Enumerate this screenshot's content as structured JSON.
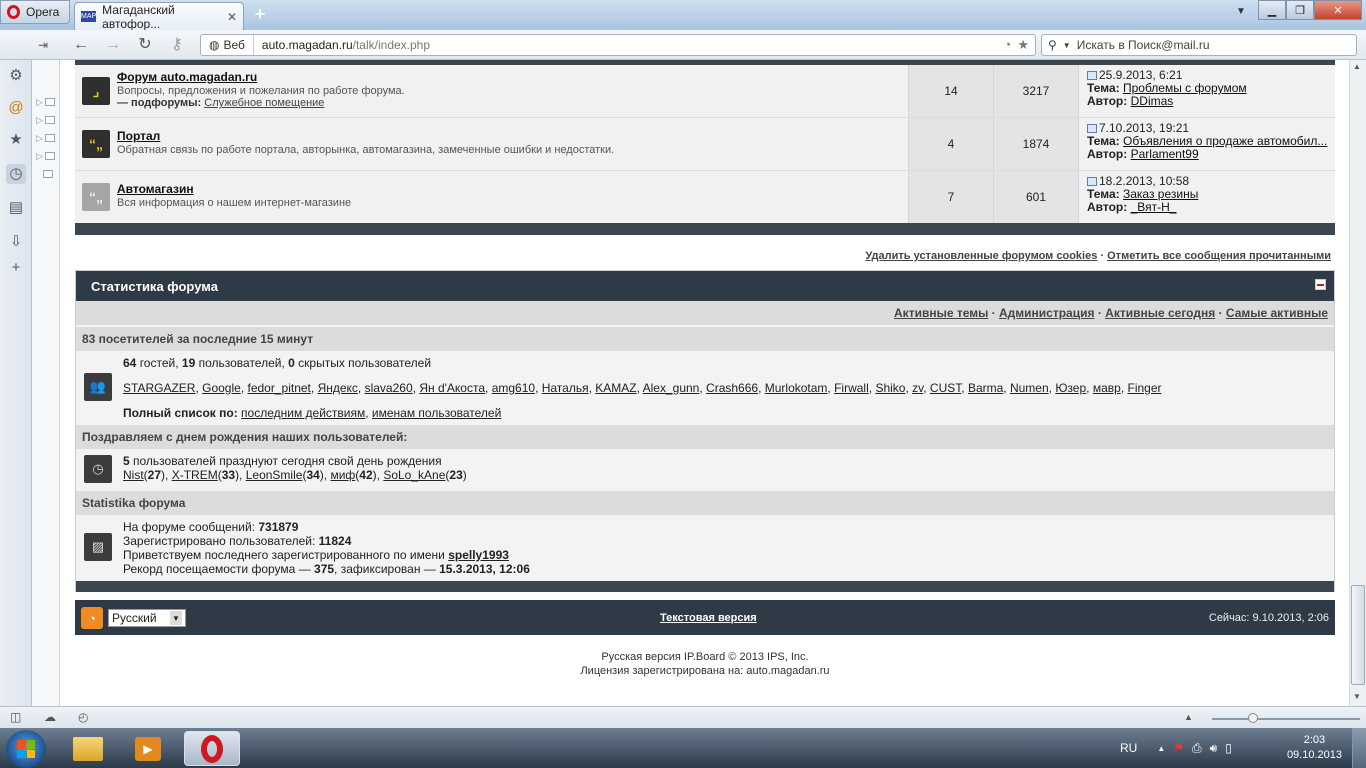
{
  "browser": {
    "menu_label": "Opera",
    "tab_title": "Магаданский автофор...",
    "tab_favicon": "MAP",
    "address_scheme_label": "Веб",
    "url_host": "auto.magadan.ru",
    "url_path": "/talk/index.php",
    "search_placeholder": "Искать в Поиск@mail.ru"
  },
  "forums": [
    {
      "title": "Форум auto.magadan.ru",
      "desc": "Вопросы, предложения и пожелания по работе форума.",
      "subforums_label": "— подфорумы:",
      "subforum": "Служебное помещение",
      "topics": "14",
      "posts": "3217",
      "last_date": "25.9.2013, 6:21",
      "topic_label": "Тема:",
      "last_topic": "Проблемы с форумом",
      "author_label": "Автор:",
      "last_author": "DDimas",
      "icon": "forum-read-icon"
    },
    {
      "title": "Портал",
      "desc": "Обратная связь по работе портала, авторынка, автомагазина, замеченные ошибки и недостатки.",
      "topics": "4",
      "posts": "1874",
      "last_date": "7.10.2013, 19:21",
      "topic_label": "Тема:",
      "last_topic": "Объявления о продаже автомобил...",
      "author_label": "Автор:",
      "last_author": "Parlament99",
      "icon": "forum-unread-icon"
    },
    {
      "title": "Автомагазин",
      "desc": "Вся информация о нашем интернет-магазине",
      "topics": "7",
      "posts": "601",
      "last_date": "18.2.2013, 10:58",
      "topic_label": "Тема:",
      "last_topic": "Заказ резины",
      "author_label": "Автор:",
      "last_author": "_Вят-Н_",
      "icon": "forum-read-icon"
    }
  ],
  "links": {
    "delete_cookies": "Удалить установленные форумом cookies",
    "mark_read": "Отметить все сообщения прочитанными",
    "sep": " · "
  },
  "stats": {
    "title": "Статистика форума",
    "tabs": [
      "Активные темы",
      "Администрация",
      "Активные сегодня",
      "Самые активные"
    ],
    "visitors_header": "83 посетителей за последние 15 минут",
    "guests": "64",
    "guests_label": " гостей, ",
    "members": "19",
    "members_label": " пользователей, ",
    "hidden": "0",
    "hidden_label": " скрытых пользователей",
    "online_users": [
      "STARGAZER",
      "Google",
      "fedor_pitnet",
      "Яндекс",
      "slava260",
      "Ян d'Акоста",
      "amg610",
      "Наталья",
      "KAMAZ",
      "Alex_gunn",
      "Crash666",
      "Murlokotam",
      "Firwall",
      "Shiko",
      "zv",
      "CUST",
      "Barma",
      "Numen",
      "Юзер",
      "мавр",
      "Finger"
    ],
    "full_list_label": "Полный список по:",
    "full_list_by_action": "последним действиям",
    "full_list_by_name": "именам пользователей",
    "birthday_header": "Поздравляем с днем рождения наших пользователей:",
    "birthday_count": "5",
    "birthday_text": " пользователей празднуют сегодня свой день рождения",
    "birthdays": [
      {
        "name": "Nist",
        "age": "27"
      },
      {
        "name": "X-TREM",
        "age": "33"
      },
      {
        "name": "LeonSmile",
        "age": "34"
      },
      {
        "name": "миф",
        "age": "42"
      },
      {
        "name": "SoLo_kAne",
        "age": "23"
      }
    ],
    "board_stats_header": "Statistika форума",
    "posts_label": "На форуме сообщений: ",
    "posts_value": "731879",
    "registered_label": "Зарегистрировано пользователей: ",
    "registered_value": "11824",
    "newest_label": "Приветствуем последнего зарегистрированного по имени ",
    "newest_value": "spelly1993",
    "record_label": "Рекорд посещаемости форума — ",
    "record_value": "375",
    "record_mid": ", зафиксирован — ",
    "record_date": "15.3.2013, 12:06"
  },
  "footer": {
    "language": "Русский",
    "text_version": "Текстовая версия",
    "now": "Сейчас: 9.10.2013, 2:06",
    "copyright": "Русская версия IP.Board © 2013  IPS, Inc.",
    "license": "Лицензия зарегистрирована на: auto.magadan.ru"
  },
  "taskbar": {
    "lang": "RU",
    "time": "2:03",
    "date": "09.10.2013"
  },
  "colors": {
    "header_dark": "#2e3b47",
    "highlight_circle": "#e0101a",
    "rss": "#f08a24"
  }
}
